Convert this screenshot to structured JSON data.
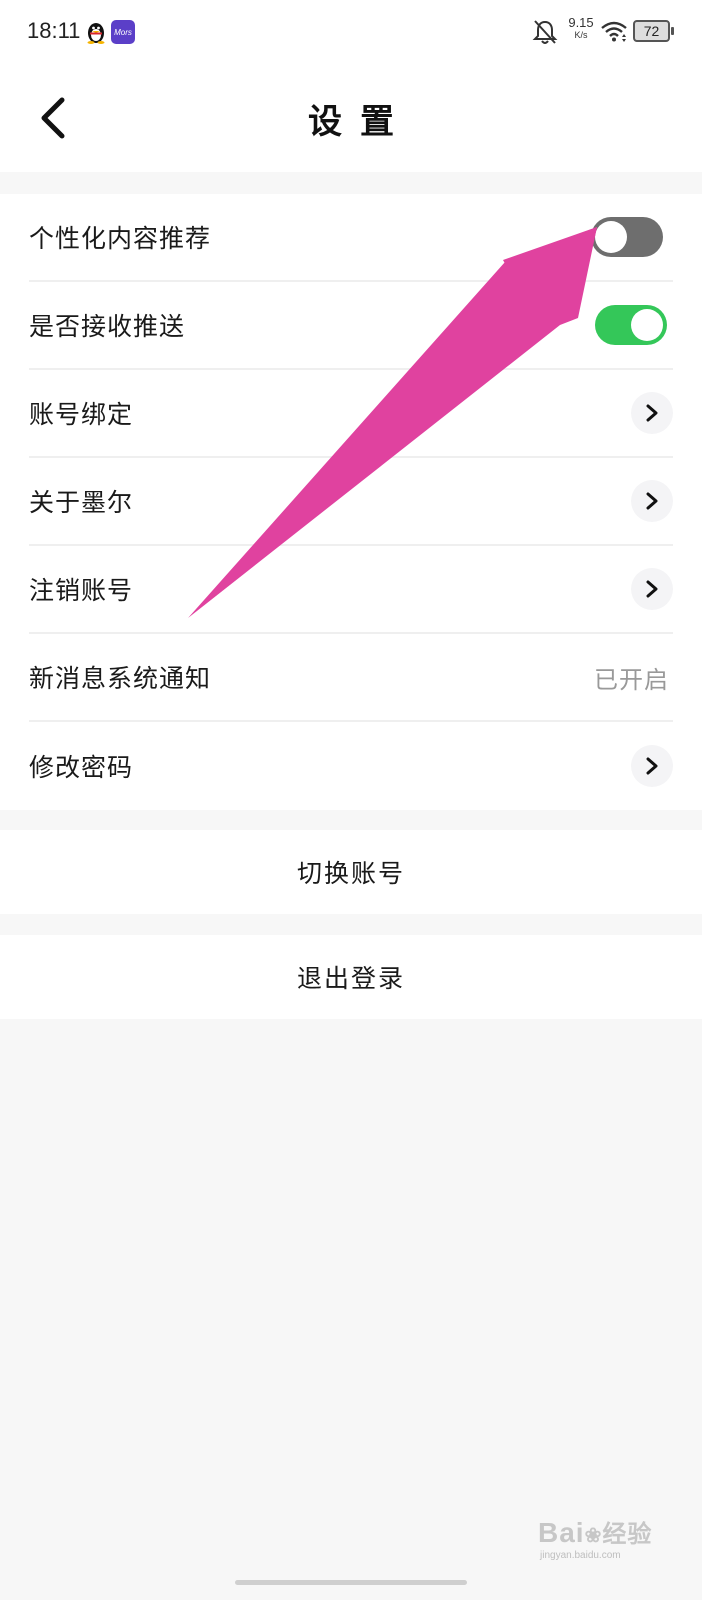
{
  "status_bar": {
    "time": "18:11",
    "app_badge": "Mors",
    "net_speed_value": "9.15",
    "net_speed_unit": "K/s",
    "battery": "72"
  },
  "header": {
    "title": "设置"
  },
  "settings": {
    "items": [
      {
        "label": "个性化内容推荐",
        "control": "toggle",
        "on": false
      },
      {
        "label": "是否接收推送",
        "control": "toggle",
        "on": true
      },
      {
        "label": "账号绑定",
        "control": "chevron"
      },
      {
        "label": "关于墨尔",
        "control": "chevron"
      },
      {
        "label": "注销账号",
        "control": "chevron"
      },
      {
        "label": "新消息系统通知",
        "control": "value",
        "value": "已开启"
      },
      {
        "label": "修改密码",
        "control": "chevron"
      }
    ]
  },
  "actions": {
    "switch_account": "切换账号",
    "logout": "退出登录"
  },
  "colors": {
    "toggle_on": "#34c759",
    "toggle_off": "#6e6e6e",
    "annotation_arrow": "#e0429f"
  },
  "watermark": {
    "brand": "Bai",
    "brand_cn": "经验",
    "url": "jingyan.baidu.com"
  }
}
